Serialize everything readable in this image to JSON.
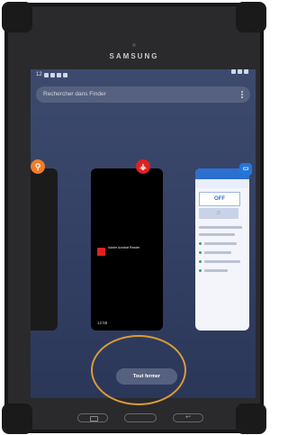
{
  "device": {
    "brand": "SAMSUNG"
  },
  "status_bar": {
    "time": "12"
  },
  "search": {
    "placeholder": "Rechercher dans Finder"
  },
  "recent_apps": {
    "center_card": {
      "app_name": "Adobe Acrobat Reader",
      "clock": "12:58"
    },
    "right_card": {
      "toggle_label": "OFF",
      "second_label": "D"
    }
  },
  "actions": {
    "close_all_label": "Tout fermer"
  },
  "colors": {
    "accent": "#2d6fcf",
    "annotation": "#d99a3a",
    "pdf_red": "#e0221e"
  }
}
